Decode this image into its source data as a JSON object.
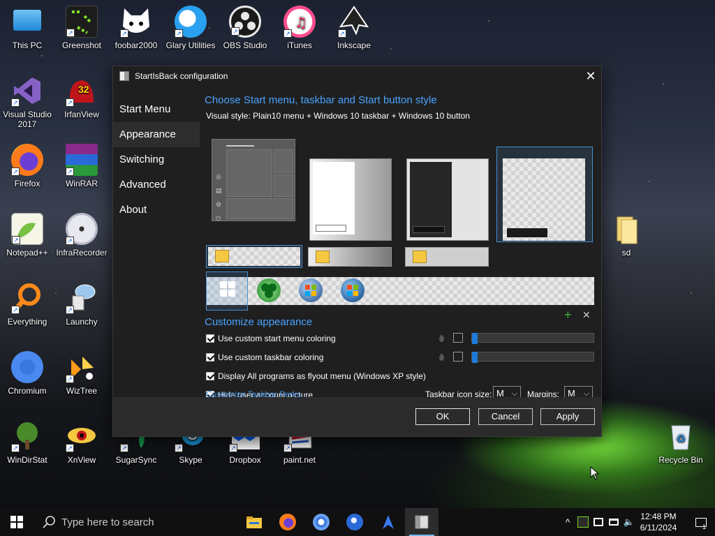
{
  "desktop_icons": [
    {
      "label": "This PC"
    },
    {
      "label": "Greenshot"
    },
    {
      "label": "foobar2000"
    },
    {
      "label": "Glary Utilities"
    },
    {
      "label": "OBS Studio"
    },
    {
      "label": "iTunes"
    },
    {
      "label": "Inkscape"
    },
    {
      "label": "Visual Studio 2017"
    },
    {
      "label": "IrfanView"
    },
    {
      "label": "Firefox"
    },
    {
      "label": "WinRAR"
    },
    {
      "label": "Notepad++"
    },
    {
      "label": "InfraRecorder"
    },
    {
      "label": "Everything"
    },
    {
      "label": "Launchy"
    },
    {
      "label": "Chromium"
    },
    {
      "label": "WizTree"
    },
    {
      "label": "WinDirStat"
    },
    {
      "label": "XnView"
    },
    {
      "label": "SugarSync"
    },
    {
      "label": "Skype"
    },
    {
      "label": "Dropbox"
    },
    {
      "label": "paint.net"
    },
    {
      "label": "sd"
    },
    {
      "label": "Recycle Bin"
    }
  ],
  "irfanview_badge": "32",
  "dialog": {
    "title": "StartIsBack configuration",
    "close_glyph": "✕",
    "nav": [
      "Start Menu",
      "Appearance",
      "Switching",
      "Advanced",
      "About"
    ],
    "active_nav": "Appearance",
    "heading": "Choose Start menu, taskbar and Start button style",
    "visual_style": "Visual style:  Plain10 menu + Windows 10 taskbar + Windows 10 button",
    "customize_heading": "Customize appearance",
    "add_glyph": "+",
    "remove_glyph": "✕",
    "options": [
      {
        "label": "Use custom start menu coloring",
        "checked": true
      },
      {
        "label": "Use custom taskbar coloring",
        "checked": true
      },
      {
        "label": "Display All programs as flyout menu (Windows XP style)",
        "checked": true
      },
      {
        "label": "Hide user account picture",
        "checked": true
      }
    ],
    "start_menu_slider_value": 0,
    "taskbar_slider_value": 0,
    "perks_link": "Customize Taskbar Perks...",
    "icon_size_label": "Taskbar icon size:",
    "icon_size_value": "M",
    "margins_label": "Margins:",
    "margins_value": "M",
    "buttons": {
      "ok": "OK",
      "cancel": "Cancel",
      "apply": "Apply"
    }
  },
  "taskbar": {
    "search_placeholder": "Type here to search",
    "time": "12:48 PM",
    "date": "6/11/2024",
    "notification_count": "1"
  },
  "colors": {
    "accent": "#4aa3ff",
    "link": "#3d8ee0",
    "slider_knob": "#1e7ad8"
  }
}
